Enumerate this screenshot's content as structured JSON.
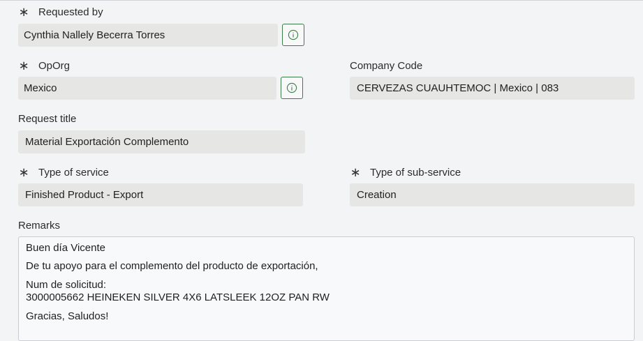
{
  "form": {
    "requested_by": {
      "label": "Requested by",
      "required": true,
      "value": "Cynthia Nallely Becerra Torres"
    },
    "oporg": {
      "label": "OpOrg",
      "required": true,
      "value": "Mexico"
    },
    "company_code": {
      "label": "Company Code",
      "value": "CERVEZAS CUAUHTEMOC | Mexico | 083"
    },
    "request_title": {
      "label": "Request title",
      "value": "Material Exportación Complemento"
    },
    "type_of_service": {
      "label": "Type of service",
      "required": true,
      "value": "Finished Product - Export"
    },
    "type_of_sub_service": {
      "label": "Type of sub-service",
      "required": true,
      "value": "Creation"
    },
    "remarks": {
      "label": "Remarks",
      "lines": [
        "Buen día Vicente",
        "De tu apoyo para el complemento del producto de exportación,",
        "Num de solicitud:",
        "3000005662 HEINEKEN SILVER 4X6 LATSLEEK 12OZ PAN RW",
        "Gracias, Saludos!"
      ]
    },
    "required_marker": "∗",
    "icons": {
      "info": "info-circle-icon",
      "accent": "#3a7d4a"
    }
  }
}
